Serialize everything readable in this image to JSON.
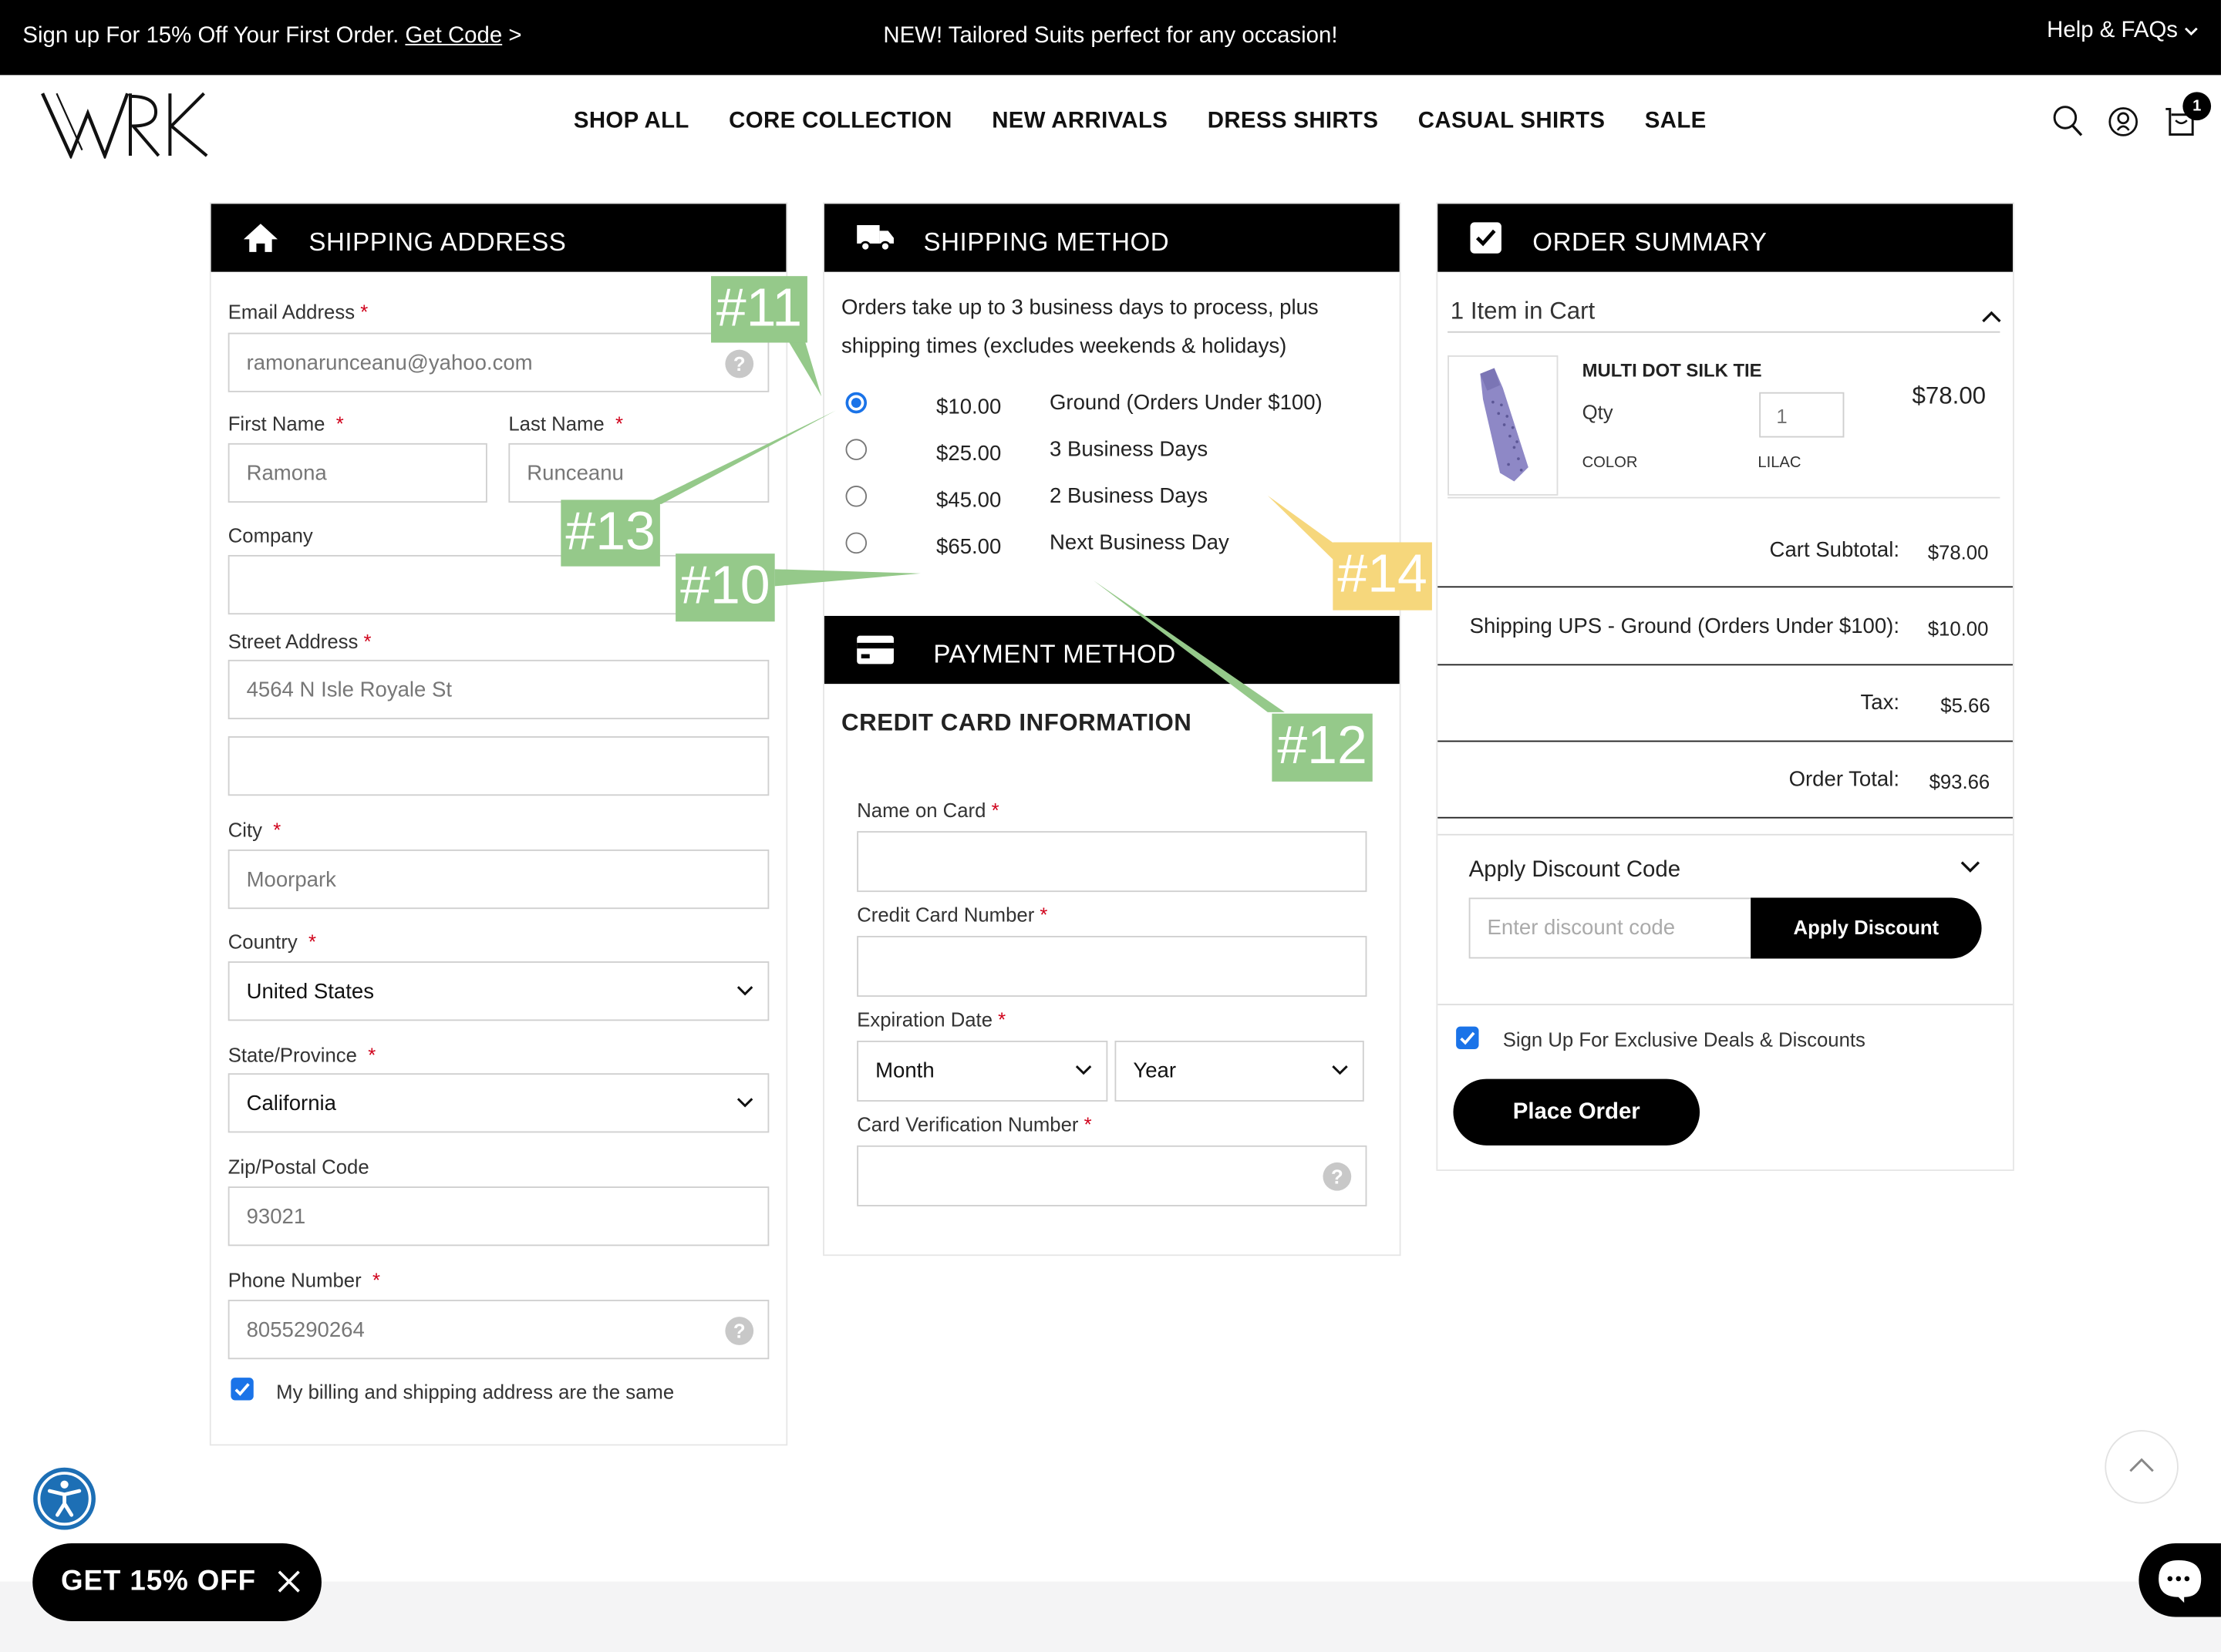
{
  "topbar": {
    "promo_text": "Sign up For 15% Off Your First Order.",
    "promo_link": "Get Code",
    "promo_arrow": ">",
    "center_text": "NEW! Tailored Suits perfect for any occasion!",
    "help": "Help & FAQs"
  },
  "nav": [
    "SHOP ALL",
    "CORE COLLECTION",
    "NEW ARRIVALS",
    "DRESS SHIRTS",
    "CASUAL SHIRTS",
    "SALE"
  ],
  "cart_count": "1",
  "shipping_address": {
    "title": "SHIPPING ADDRESS",
    "email_label": "Email Address",
    "email_value": "ramonarunceanu@yahoo.com",
    "first_label": "First Name",
    "first_value": "Ramona",
    "last_label": "Last Name",
    "last_value": "Runceanu",
    "company_label": "Company",
    "street_label": "Street Address",
    "street_value": "4564 N Isle Royale St",
    "city_label": "City",
    "city_value": "Moorpark",
    "country_label": "Country",
    "country_value": "United States",
    "state_label": "State/Province",
    "state_value": "California",
    "zip_label": "Zip/Postal Code",
    "zip_value": "93021",
    "phone_label": "Phone Number",
    "phone_value": "8055290264",
    "same_address_label": "My billing and shipping address are the same",
    "required_mark": "*",
    "help_mark": "?"
  },
  "shipping_method": {
    "title": "SHIPPING METHOD",
    "note_line1": "Orders take up to 3 business days to process, plus",
    "note_line2": "shipping times (excludes weekends & holidays)",
    "options": [
      {
        "price": "$10.00",
        "label": "Ground (Orders Under $100)",
        "selected": true
      },
      {
        "price": "$25.00",
        "label": "3 Business Days",
        "selected": false
      },
      {
        "price": "$45.00",
        "label": "2 Business Days",
        "selected": false
      },
      {
        "price": "$65.00",
        "label": "Next Business Day",
        "selected": false
      }
    ]
  },
  "payment": {
    "title": "PAYMENT METHOD",
    "subtitle": "CREDIT CARD INFORMATION",
    "name_label": "Name on Card",
    "number_label": "Credit Card Number",
    "exp_label": "Expiration Date",
    "month_value": "Month",
    "year_value": "Year",
    "cvv_label": "Card Verification Number"
  },
  "order_summary": {
    "title": "ORDER SUMMARY",
    "items_in_cart": "1 Item in Cart",
    "item_name": "MULTI DOT SILK TIE",
    "qty_label": "Qty",
    "qty_value": "1",
    "color_label": "COLOR",
    "color_value": "LILAC",
    "item_price": "$78.00",
    "subtotal_label": "Cart Subtotal:",
    "subtotal_value": "$78.00",
    "shipping_label": "Shipping UPS - Ground (Orders Under $100):",
    "shipping_value": "$10.00",
    "tax_label": "Tax:",
    "tax_value": "$5.66",
    "total_label": "Order Total:",
    "total_value": "$93.66",
    "discount_heading": "Apply Discount Code",
    "discount_placeholder": "Enter discount code",
    "discount_button": "Apply Discount",
    "signup_label": "Sign Up For Exclusive Deals & Discounts",
    "place_order": "Place Order"
  },
  "promo_pill": "GET 15% OFF",
  "annotations": [
    "#10",
    "#11",
    "#12",
    "#13",
    "#14"
  ],
  "colors": {
    "accent_blue": "#1a73e8",
    "annotation_green": "#95c98a",
    "annotation_yellow": "#f6d77c",
    "accessibility_blue": "#1d6fb5"
  }
}
